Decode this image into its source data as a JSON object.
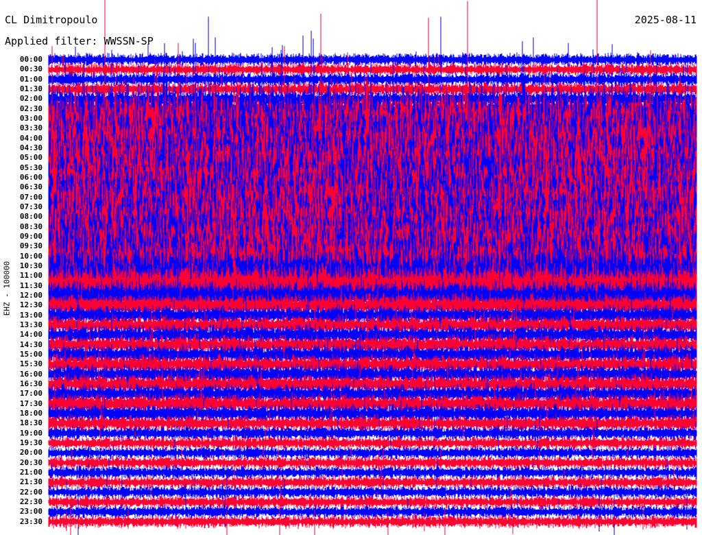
{
  "header": {
    "station": "CL Dimitropoulo",
    "date": "2025-08-11",
    "filter": "Applied filter: WWSSN-SP"
  },
  "chart_data": {
    "type": "line",
    "title": "CL Dimitropoulo",
    "ylabel": "EHZ - 100000",
    "row_labels": [
      "00:00",
      "00:30",
      "01:00",
      "01:30",
      "02:00",
      "02:30",
      "03:00",
      "03:30",
      "04:00",
      "04:30",
      "05:00",
      "05:30",
      "06:00",
      "06:30",
      "07:00",
      "07:30",
      "08:00",
      "08:30",
      "09:00",
      "09:30",
      "10:00",
      "10:30",
      "11:00",
      "11:30",
      "12:00",
      "12:30",
      "13:00",
      "13:30",
      "14:00",
      "14:30",
      "15:00",
      "15:30",
      "16:00",
      "16:30",
      "17:00",
      "17:30",
      "18:00",
      "18:30",
      "19:00",
      "19:30",
      "20:00",
      "20:30",
      "21:00",
      "21:30",
      "22:00",
      "22:30",
      "23:00",
      "23:30"
    ],
    "relative_amplitude": [
      0.1,
      0.1,
      0.12,
      0.12,
      0.15,
      0.2,
      0.9,
      1,
      1,
      1,
      1,
      1,
      1,
      1,
      1,
      1,
      1,
      1,
      1,
      1,
      1,
      1,
      0.9,
      0.6,
      0.35,
      0.25,
      0.2,
      0.2,
      0.2,
      0.2,
      0.2,
      0.2,
      0.2,
      0.2,
      0.2,
      0.2,
      0.18,
      0.15,
      0.12,
      0.1,
      0.1,
      0.1,
      0.1,
      0.1,
      0.1,
      0.1,
      0.1,
      0.1
    ],
    "colors": [
      "#0000ff",
      "#ff0033"
    ]
  }
}
